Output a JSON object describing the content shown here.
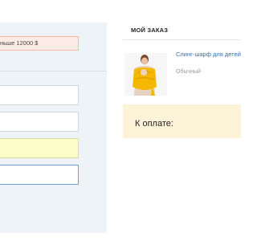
{
  "form": {
    "alert_text": "ньше 12000 $",
    "fields": [
      {
        "value": "",
        "placeholder": ""
      },
      {
        "value": "",
        "placeholder": ""
      },
      {
        "value": "",
        "placeholder": ""
      },
      {
        "value": "",
        "placeholder": ""
      }
    ]
  },
  "order": {
    "title": "МОЙ ЗАКАЗ",
    "product": {
      "name": "Слинг-шарф для детей",
      "variant": "Обычный",
      "image": "sling-scarf-product-photo"
    },
    "total_label": "К оплате:"
  },
  "colors": {
    "left_panel_bg": "#eef3f8",
    "alert_bg": "#fdece6",
    "alert_border": "#f3b9a8",
    "highlight_field_bg": "#fdfdc9",
    "focused_field_border": "#6f9fd8",
    "total_box_bg": "#fdf3d9",
    "link": "#2f6fbf",
    "product_scarf": "#f5b800"
  }
}
